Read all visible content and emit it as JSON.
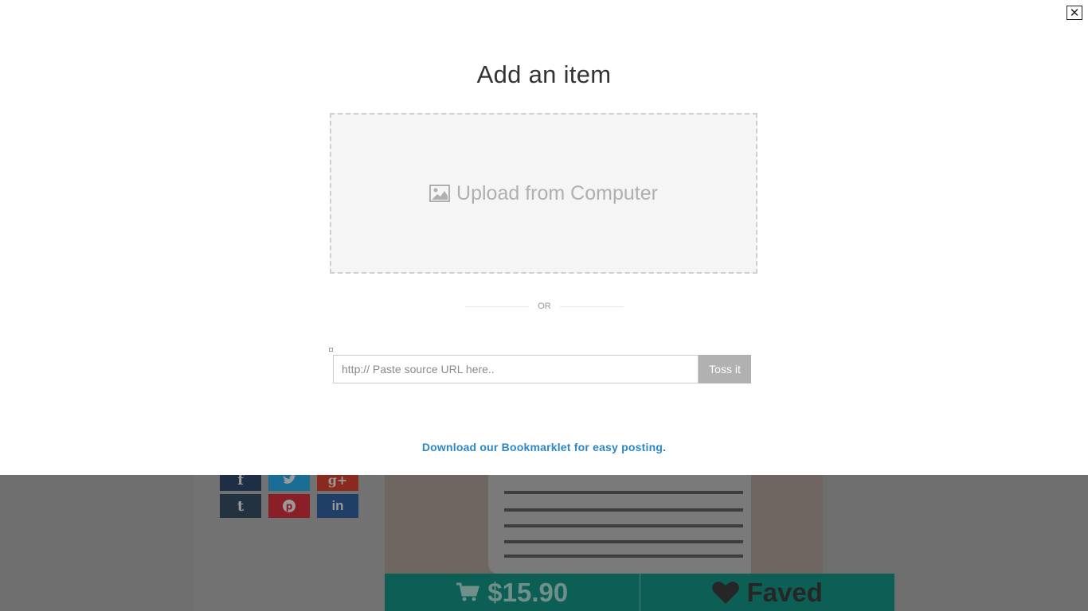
{
  "modal": {
    "title": "Add an item",
    "close_icon": "close-icon",
    "upload": {
      "label": "Upload from Computer",
      "icon": "image-icon"
    },
    "divider_text": "OR",
    "url_input": {
      "placeholder": "http:// Paste source URL here..",
      "value": ""
    },
    "submit_label": "Toss it",
    "bookmarklet_link": "Download our Bookmarklet for easy posting."
  },
  "background": {
    "share_buttons": [
      {
        "icon": "facebook-icon",
        "color": "#1e2f45"
      },
      {
        "icon": "twitter-icon",
        "color": "#1a6e96"
      },
      {
        "icon": "google-plus-icon",
        "color": "#8a2a1f"
      },
      {
        "icon": "tumblr-icon",
        "color": "#233241"
      },
      {
        "icon": "pinterest-icon",
        "color": "#8a1f27"
      },
      {
        "icon": "linkedin-icon",
        "color": "#1f3f66"
      }
    ],
    "price": "$15.90",
    "cart_icon": "cart-icon",
    "fave_label": "Faved",
    "heart_icon": "heart-icon",
    "accent_color": "#0d5e55"
  }
}
